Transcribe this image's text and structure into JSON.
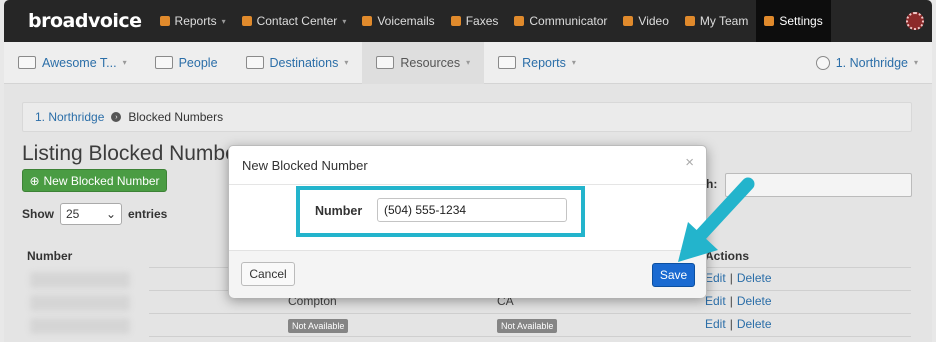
{
  "app": {
    "logo": "broadvoice"
  },
  "topnav": [
    {
      "label": "Reports",
      "caret": "▾",
      "icon": "bar-chart-icon"
    },
    {
      "label": "Contact Center",
      "caret": "▾",
      "icon": "headset-icon"
    },
    {
      "label": "Voicemails",
      "icon": "envelope-icon"
    },
    {
      "label": "Faxes",
      "icon": "fax-icon"
    },
    {
      "label": "Communicator",
      "icon": "chat-icon"
    },
    {
      "label": "Video",
      "icon": "video-icon"
    },
    {
      "label": "My Team",
      "icon": "team-icon"
    },
    {
      "label": "Settings",
      "icon": "gear-icon",
      "active": true
    }
  ],
  "subnav": [
    {
      "label": "Awesome T...",
      "caret": "▾",
      "icon": "home-icon"
    },
    {
      "label": "People",
      "icon": "people-icon"
    },
    {
      "label": "Destinations",
      "caret": "▾",
      "icon": "destinations-icon"
    },
    {
      "label": "Resources",
      "caret": "▾",
      "icon": "resources-icon",
      "active": true
    },
    {
      "label": "Reports",
      "caret": "▾",
      "icon": "reports-icon"
    }
  ],
  "subnav_right": {
    "label": "1. Northridge",
    "caret": "▾",
    "icon": "location-icon"
  },
  "breadcrumb": {
    "link": "1. Northridge",
    "sep": "›",
    "current": "Blocked Numbers"
  },
  "page": {
    "title": "Listing Blocked Numbe",
    "new_button": "New Blocked Number",
    "new_button_icon": "⊕",
    "show_label": "Show",
    "entries_label": "entries",
    "page_size": "25",
    "search_label": "h:"
  },
  "table": {
    "columns": {
      "number": "Number",
      "actions": "Actions"
    },
    "rows": [
      {
        "city": "",
        "state": "",
        "edit": "Edit",
        "sep": "|",
        "delete": "Delete"
      },
      {
        "city": "Compton",
        "state": "CA",
        "edit": "Edit",
        "sep": "|",
        "delete": "Delete"
      },
      {
        "city": "Not Available",
        "state": "Not Available",
        "edit": "Edit",
        "sep": "|",
        "delete": "Delete"
      }
    ]
  },
  "modal": {
    "title": "New Blocked Number",
    "close": "×",
    "field_label": "Number",
    "field_value": "(504) 555-1234",
    "cancel": "Cancel",
    "save": "Save"
  },
  "colors": {
    "highlight": "#23b4cc",
    "save": "#1a6ad1",
    "new_button": "#4a9c43",
    "link": "#2b6ea8"
  }
}
